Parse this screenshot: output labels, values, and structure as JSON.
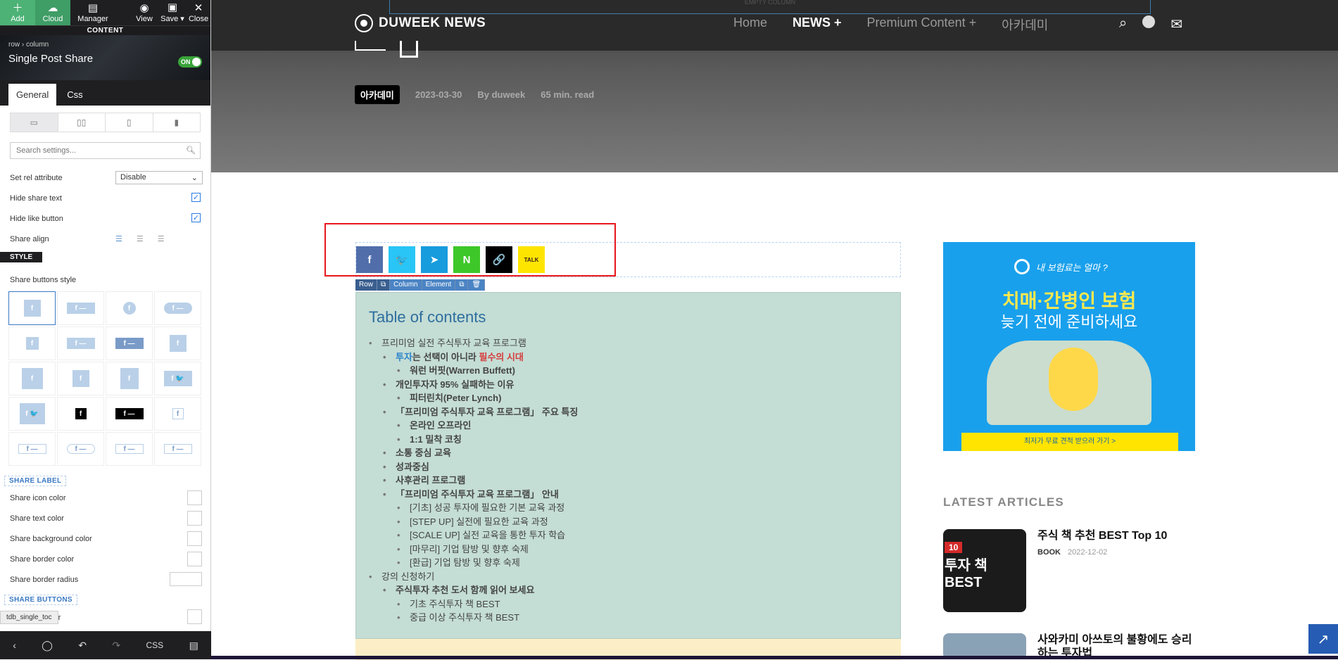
{
  "toolbar": {
    "add": "Add",
    "cloud": "Cloud",
    "manager": "Manager",
    "view": "View",
    "save": "Save ▾",
    "close": "Close",
    "section": "CONTENT"
  },
  "panel": {
    "breadcrumb": "row › column",
    "title": "Single Post Share",
    "toggle": "ON",
    "tabs": [
      "General",
      "Css"
    ],
    "search_placeholder": "Search settings...",
    "rel_label": "Set rel attribute",
    "rel_value": "Disable",
    "hide_share_text": "Hide share text",
    "hide_like_button": "Hide like button",
    "share_align": "Share align",
    "style_badge": "STYLE",
    "buttons_style": "Share buttons style",
    "share_label_section": "SHARE LABEL",
    "share_icon_color": "Share icon color",
    "share_text_color": "Share text color",
    "share_bg_color": "Share background color",
    "share_border_color": "Share border color",
    "share_border_radius": "Share border radius",
    "share_buttons_section": "SHARE BUTTONS",
    "partial_label": "olor",
    "element_tag": "tdb_single_toc",
    "css_btn": "CSS"
  },
  "site": {
    "empty_column": "EMPTY COLUMN",
    "logo": "DUWEEK NEWS",
    "menu": [
      "Home",
      "NEWS +",
      "Premium Content +",
      "아카데미"
    ],
    "category": "아카데미",
    "date": "2023-03-30",
    "author": "By duweek",
    "read_time": "65 min. read"
  },
  "share_buttons": [
    {
      "name": "facebook",
      "glyph": "f",
      "color": "#516eab"
    },
    {
      "name": "twitter",
      "glyph": "🐦",
      "color": "#29c5f6"
    },
    {
      "name": "telegram",
      "glyph": "➤",
      "color": "#179cde"
    },
    {
      "name": "naver",
      "glyph": "N",
      "color": "#3ec729"
    },
    {
      "name": "copy-link",
      "glyph": "🔗",
      "color": "#000000"
    },
    {
      "name": "kakao",
      "glyph": "TALK",
      "color": "#fee500"
    }
  ],
  "row_tools": [
    "Row",
    "⧉",
    "Column",
    "Element",
    "⧉",
    "🗑"
  ],
  "toc": {
    "title": "Table of contents",
    "items": [
      {
        "level": 1,
        "text": "프리미엄 실전 주식투자 교육 프로그램"
      },
      {
        "level": 2,
        "parts": [
          {
            "t": "투자",
            "c": "blue"
          },
          {
            "t": "는 선택이 아니라 ",
            "c": ""
          },
          {
            "t": "필수의 시대",
            "c": "red"
          }
        ]
      },
      {
        "level": 3,
        "text": "워런 버핏(Warren Buffett)"
      },
      {
        "level": 2,
        "text": "개인투자자 95% 실패하는 이유"
      },
      {
        "level": 3,
        "text": "피터린치(Peter Lynch)"
      },
      {
        "level": 2,
        "text": "「프리미엄 주식투자 교육 프로그램」 주요 특징"
      },
      {
        "level": 3,
        "text": "온라인 오프라인"
      },
      {
        "level": 3,
        "text": "1:1 밀착 코칭"
      },
      {
        "level": 2,
        "text": "소통 중심 교육"
      },
      {
        "level": 2,
        "text": "성과중심"
      },
      {
        "level": 2,
        "text": "사후관리 프로그램"
      },
      {
        "level": 2,
        "text": "「프리미엄 주식투자 교육 프로그램」 안내"
      },
      {
        "level": 4,
        "text": "[기초] 성공 투자에 필요한 기본 교육 과정"
      },
      {
        "level": 4,
        "text": "[STEP UP] 실전에 필요한 교육 과정"
      },
      {
        "level": 4,
        "text": "[SCALE UP] 실전 교육을 통한 투자 학습"
      },
      {
        "level": 4,
        "text": "[마무리] 기업 탐방 및 향후 숙제"
      },
      {
        "level": 4,
        "text": "[환급] 기업 탐방 및 향후 숙제"
      },
      {
        "level": 1,
        "text": "강의 신청하기"
      },
      {
        "level": 5,
        "text": "주식투자 추천 도서 함께 읽어 보세요"
      },
      {
        "level": 4,
        "text": "기초 주식투자 책 BEST"
      },
      {
        "level": 4,
        "text": "중급 이상 주식투자 책 BEST"
      }
    ]
  },
  "ad": {
    "question": "내 보험료는 얼마 ?",
    "headline": "치매·간병인 보험",
    "subline": "늦기 전에 준비하세요",
    "cta": "최저가 무료 견적 받으러 가기 >"
  },
  "sidebar": {
    "latest_title": "LATEST ARTICLES",
    "articles": [
      {
        "title": "주식 책 추천 BEST Top 10",
        "category": "BOOK",
        "date": "2022-12-02",
        "thumb_badge": "10",
        "thumb_text": "투자 책 BEST"
      },
      {
        "title": "사와카미 아쓰토의 불황에도 승리하는 투자법",
        "category": "",
        "date": "",
        "thumb_badge": "",
        "thumb_text": ""
      }
    ]
  }
}
